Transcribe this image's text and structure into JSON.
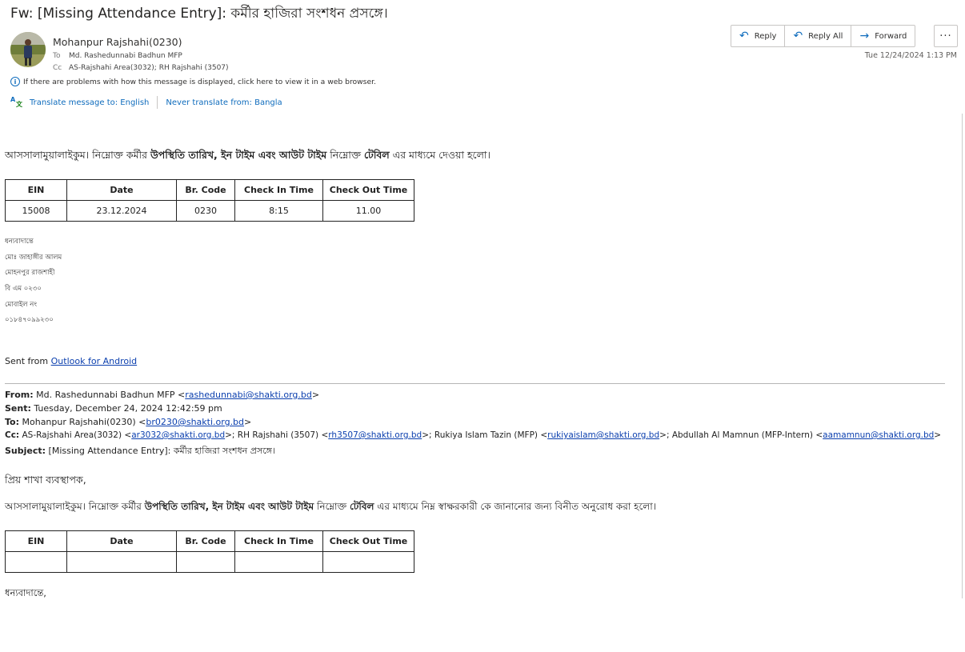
{
  "subject": "Fw: [Missing Attendance Entry]: কর্মীর হাজিরা সংশধন প্রসঙ্গে।",
  "sender": {
    "name": "Mohanpur Rajshahi(0230)",
    "to_label": "To",
    "to": "Md. Rashedunnabi Badhun MFP",
    "cc_label": "Cc",
    "cc": "AS-Rajshahi Area(3032); RH Rajshahi (3507)"
  },
  "actions": {
    "reply": "Reply",
    "reply_all": "Reply All",
    "forward": "Forward",
    "more": "···"
  },
  "date": "Tue 12/24/2024 1:13 PM",
  "info_bar": "If there are problems with how this message is displayed, click here to view it in a web browser.",
  "translate": {
    "translate_label": "Translate message to: English",
    "never_label": "Never translate from: Bangla"
  },
  "message": {
    "intro_1": "আসসালামুয়ালাইকুম। নিম্নোক্ত কর্মীর",
    "intro_bold": "উপস্থিতি তারিখ, ইন টাইম এবং আউট টাইম",
    "intro_2": "নিম্নোক্ত",
    "intro_bold2": "টেবিল",
    "intro_3": "এর মাধ্যমে দেওয়া হলো।",
    "table_headers": [
      "EIN",
      "Date",
      "Br. Code",
      "Check In Time",
      "Check Out Time"
    ],
    "table_row": [
      "15008",
      "23.12.2024",
      "0230",
      "8:15",
      "11.00"
    ],
    "signature": [
      "ধন্যবাদান্তে",
      "মোঃ জাহাঙ্গীর আলম",
      "মোহনপুর রাজশাহী",
      "বি এম ০২৩০",
      "মোবাইল নং",
      "০১৮৪৭০৯৯২৩০"
    ],
    "sent_from_prefix": "Sent from",
    "sent_from_link": "Outlook for Android"
  },
  "forwarded": {
    "from_label": "From:",
    "from_name": "Md. Rashedunnabi Badhun MFP",
    "from_email": "rashedunnabi@shakti.org.bd",
    "sent_label": "Sent:",
    "sent_value": "Tuesday, December 24, 2024 12:42:59 pm",
    "to_label": "To:",
    "to_name": "Mohanpur Rajshahi(0230)",
    "to_email": "br0230@shakti.org.bd",
    "cc_label": "Cc:",
    "cc_1_name": "AS-Rajshahi Area(3032)",
    "cc_1_email": "ar3032@shakti.org.bd",
    "cc_2_name": "RH Rajshahi (3507)",
    "cc_2_email": "rh3507@shakti.org.bd",
    "cc_3_name": "Rukiya Islam Tazin (MFP)",
    "cc_3_email": "rukiyaislam@shakti.org.bd",
    "cc_4_name": "Abdullah Al Mamnun (MFP-Intern)",
    "cc_4_email": "aamamnun@shakti.org.bd",
    "subject_label": "Subject:",
    "subject_value": "[Missing Attendance Entry]: কর্মীর হাজিরা সংশধন প্রসঙ্গে।",
    "greeting": "প্রিয় শাখা ব্যবস্থাপক,",
    "intro_1": "আসসালামুয়ালাইকুম। নিম্নোক্ত কর্মীর",
    "intro_bold": "উপস্থিতি তারিখ, ইন টাইম এবং আউট টাইম",
    "intro_2": "নিম্নোক্ত",
    "intro_bold2": "টেবিল",
    "intro_3": "এর মাধ্যমে নিম্ন স্বাক্ষরকারী কে জানানোর জন্য বিনীত অনুরোধ করা হলো।",
    "table_headers": [
      "EIN",
      "Date",
      "Br. Code",
      "Check In Time",
      "Check Out Time"
    ],
    "closing": "ধন্যবাদান্তে,"
  }
}
